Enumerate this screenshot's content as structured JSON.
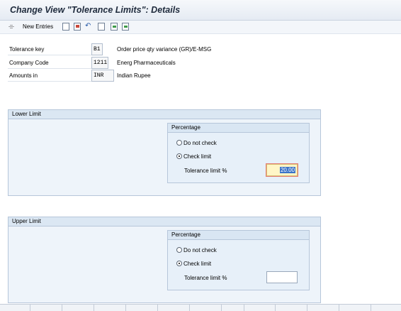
{
  "window": {
    "title": "Change View \"Tolerance Limits\": Details"
  },
  "toolbar": {
    "new_entries_label": "New Entries",
    "icons": [
      "glasses-icon",
      "copy-icon",
      "delete-icon",
      "undo-icon",
      "prev-entry-icon",
      "next-entry-icon",
      "select-icon"
    ]
  },
  "header_fields": [
    {
      "label": "Tolerance key",
      "value": "B1",
      "description": "Order price qty variance (GR)/E-MSG"
    },
    {
      "label": "Company Code",
      "value": "1211",
      "description": "Energ Pharmaceuticals"
    },
    {
      "label": "Amounts in",
      "value": "INR",
      "description": "Indian Rupee"
    }
  ],
  "lower_limit": {
    "title": "Lower Limit",
    "percentage": {
      "title": "Percentage",
      "option_do_not_check": "Do not check",
      "option_check_limit": "Check limit",
      "selected": "Check limit",
      "tolerance_label": "Tolerance limit %",
      "tolerance_value": "20.00"
    }
  },
  "upper_limit": {
    "title": "Upper Limit",
    "percentage": {
      "title": "Percentage",
      "option_do_not_check": "Do not check",
      "option_check_limit": "Check limit",
      "selected": "Check limit",
      "tolerance_label": "Tolerance limit %",
      "tolerance_value": ""
    }
  }
}
